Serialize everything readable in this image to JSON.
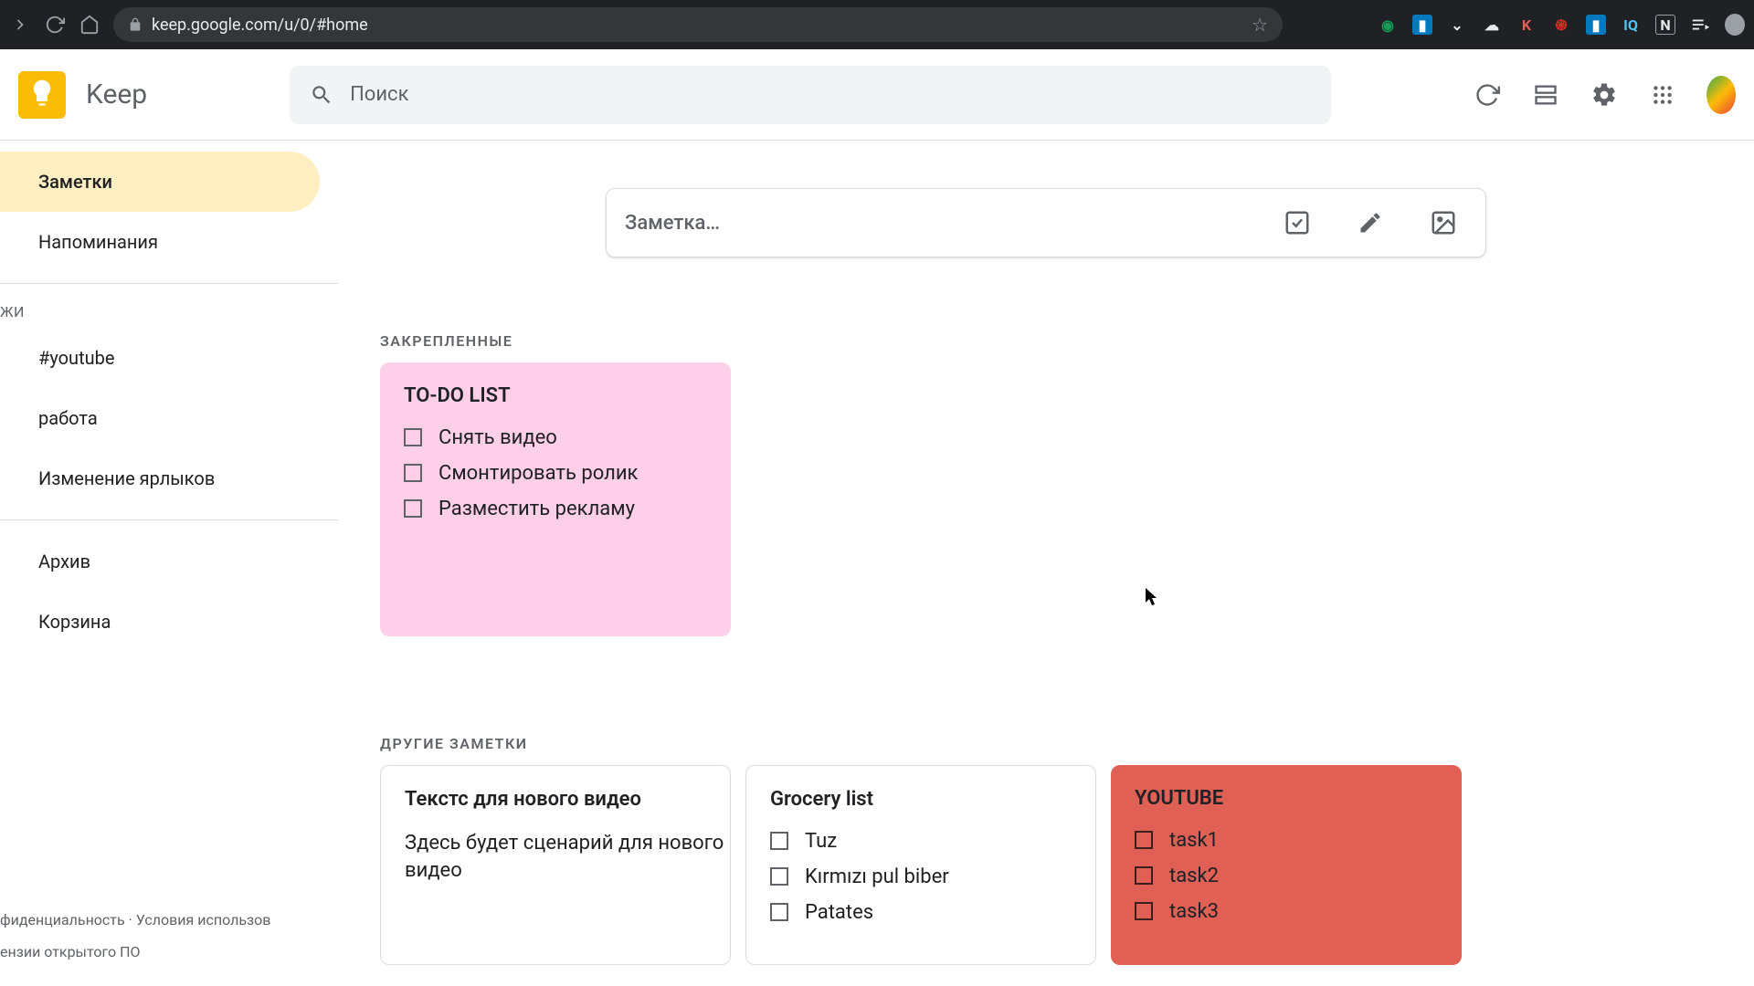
{
  "browser": {
    "url": "keep.google.com/u/0/#home"
  },
  "app": {
    "name": "Keep",
    "search_placeholder": "Поиск"
  },
  "sidebar": {
    "items": [
      {
        "label": "Заметки",
        "active": true
      },
      {
        "label": "Напоминания"
      }
    ],
    "section_label": "жи",
    "labels": [
      {
        "label": "#youtube"
      },
      {
        "label": "работа"
      },
      {
        "label": "Изменение ярлыков"
      }
    ],
    "bottom": [
      {
        "label": "Архив"
      },
      {
        "label": "Корзина"
      }
    ]
  },
  "footer": {
    "line1": "фиденциальность · Условия использов",
    "line2": "ензии открытого ПО"
  },
  "new_note": {
    "placeholder": "Заметка…"
  },
  "sections": {
    "pinned": "ЗАКРЕПЛЕННЫЕ",
    "others": "ДРУГИЕ ЗАМЕТКИ"
  },
  "pinned_notes": [
    {
      "title": "TO-DO LIST",
      "color": "pink",
      "items": [
        "Снять видео",
        "Смонтировать ролик",
        "Разместить рекламу"
      ]
    }
  ],
  "other_notes": [
    {
      "title": "Текстс для нового видео",
      "body": "Здесь будет сценарий для нового видео",
      "style": "bordered"
    },
    {
      "title": "Grocery list",
      "style": "bordered",
      "items": [
        "Tuz",
        "Kırmızı pul biber",
        "Patates"
      ]
    },
    {
      "title": "YOUTUBE",
      "style": "red",
      "items": [
        "task1",
        "task2",
        "task3"
      ]
    }
  ]
}
